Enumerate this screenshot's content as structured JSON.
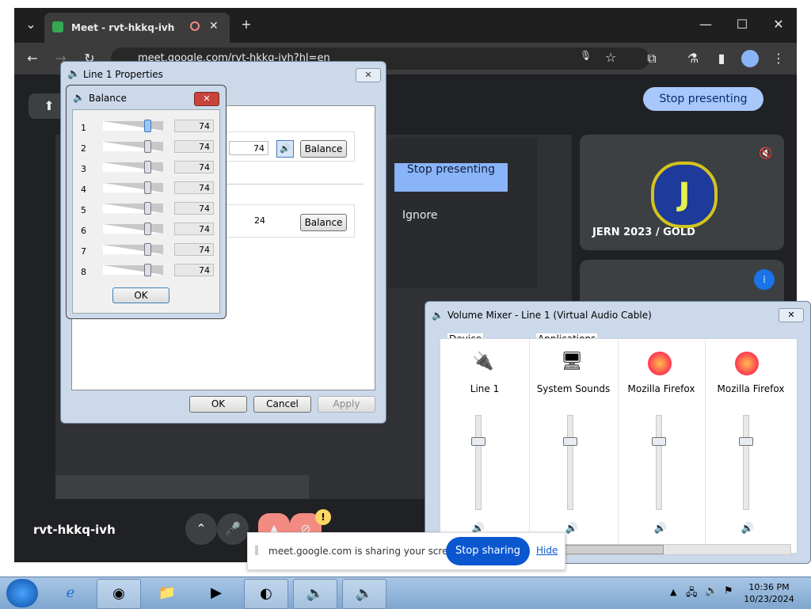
{
  "chrome": {
    "tab_title": "Meet - rvt-hkkq-ivh",
    "url": "meet.google.com/rvt-hkkq-ivh?hl=en"
  },
  "meet": {
    "stop_presenting": "Stop presenting",
    "inner_stop_presenting": "Stop presenting",
    "ignore": "Ignore",
    "participant_name": "JERN 2023 / GOLD",
    "avatar_letter": "J",
    "meeting_code": "rvt-hkkq-ivh"
  },
  "sharing_bar": {
    "message": "meet.google.com is sharing your screen.",
    "stop": "Stop sharing",
    "hide": "Hide"
  },
  "props": {
    "title": "Line 1 Properties",
    "value1": "74",
    "value2": "24",
    "balance": "Balance",
    "ok": "OK",
    "cancel": "Cancel",
    "apply": "Apply"
  },
  "balance": {
    "title": "Balance",
    "ok": "OK",
    "channels": [
      {
        "label": "1",
        "value": "74"
      },
      {
        "label": "2",
        "value": "74"
      },
      {
        "label": "3",
        "value": "74"
      },
      {
        "label": "4",
        "value": "74"
      },
      {
        "label": "5",
        "value": "74"
      },
      {
        "label": "6",
        "value": "74"
      },
      {
        "label": "7",
        "value": "74"
      },
      {
        "label": "8",
        "value": "74"
      }
    ]
  },
  "mixer": {
    "title": "Volume Mixer - Line 1 (Virtual Audio Cable)",
    "device": "Device",
    "applications": "Applications",
    "cols": [
      "Line 1",
      "System Sounds",
      "Mozilla Firefox",
      "Mozilla Firefox"
    ]
  },
  "taskbar": {
    "time": "10:36 PM",
    "date": "10/23/2024"
  }
}
